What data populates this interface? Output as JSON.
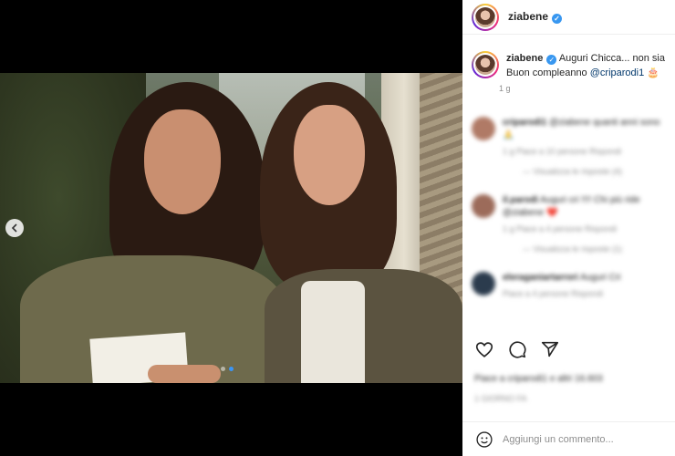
{
  "post": {
    "username": "ziabene",
    "caption_text": "Auguri Chicca... non sia",
    "caption_line2_prefix": "Buon compleanno",
    "caption_mention": "@criparodi1",
    "caption_emoji": "🎂",
    "time": "1 g"
  },
  "carousel": {
    "dots": 2,
    "active_index": 1
  },
  "comments": [
    {
      "user": "criparodi1",
      "text": "@ziabene quanti anni sono 🙏",
      "meta": "1 g   Piace a 10 persone   Rispondi",
      "replies": "— Visualizza le risposte (4)",
      "avatar_color": "#b07a66"
    },
    {
      "user": "il.parodi",
      "text": "Auguri cri !!!! Chi più ride @ziabene ❤️",
      "meta": "1 g   Piace a 4 persone   Rispondi",
      "replies": "— Visualizza le risposte (1)",
      "avatar_color": "#9c6b5a"
    },
    {
      "user": "eleraganiartarrori",
      "text": "Auguri Cri",
      "meta": "Piace a 4 persone   Rispondi",
      "replies": "",
      "avatar_color": "#2b3b4d"
    }
  ],
  "likes_text": "Piace a criparodi1 e altri 16.603",
  "likes_time": "1 GIORNO FA",
  "add_comment_placeholder": "Aggiungi un commento..."
}
